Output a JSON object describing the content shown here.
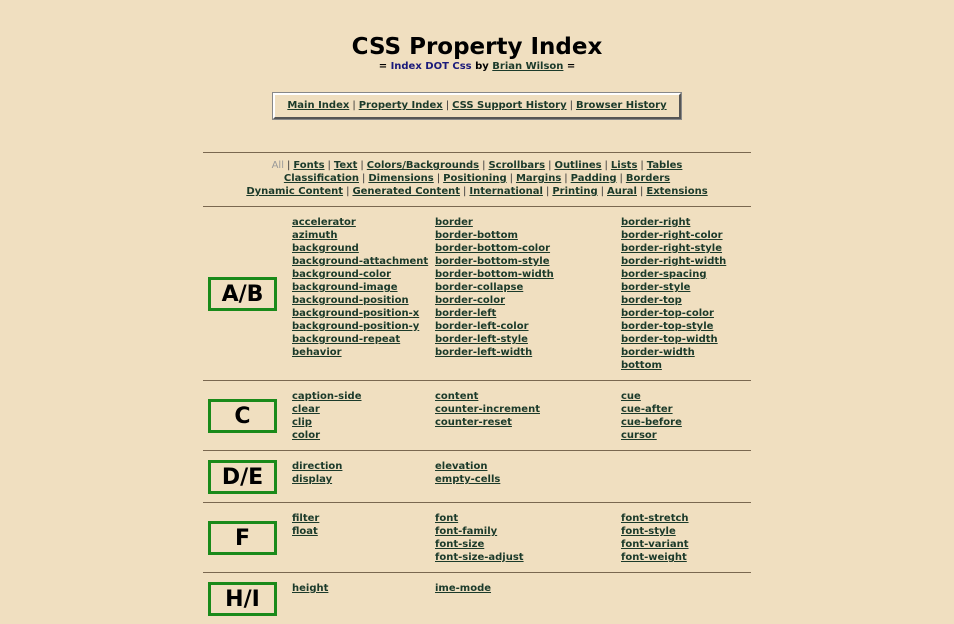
{
  "header": {
    "title": "CSS Property Index",
    "subtitle_prefix": "= ",
    "subtitle_site": "Index DOT Css",
    "subtitle_by": " by ",
    "subtitle_author": "Brian Wilson",
    "subtitle_suffix": " ="
  },
  "topnav": [
    "Main Index",
    "Property Index",
    "CSS Support History",
    "Browser History"
  ],
  "separator": "|",
  "catnav": {
    "current": "All",
    "rows": [
      [
        "Fonts",
        "Text",
        "Colors/Backgrounds",
        "Scrollbars",
        "Outlines",
        "Lists",
        "Tables"
      ],
      [
        "Classification",
        "Dimensions",
        "Positioning",
        "Margins",
        "Padding",
        "Borders"
      ],
      [
        "Dynamic Content",
        "Generated Content",
        "International",
        "Printing",
        "Aural",
        "Extensions"
      ]
    ]
  },
  "sections": [
    {
      "letter": "A/B",
      "columns": [
        [
          "accelerator",
          "azimuth",
          "background",
          "background-attachment",
          "background-color",
          "background-image",
          "background-position",
          "background-position-x",
          "background-position-y",
          "background-repeat",
          "behavior"
        ],
        [
          "border",
          "border-bottom",
          "border-bottom-color",
          "border-bottom-style",
          "border-bottom-width",
          "border-collapse",
          "border-color",
          "border-left",
          "border-left-color",
          "border-left-style",
          "border-left-width"
        ],
        [
          "border-right",
          "border-right-color",
          "border-right-style",
          "border-right-width",
          "border-spacing",
          "border-style",
          "border-top",
          "border-top-color",
          "border-top-style",
          "border-top-width",
          "border-width",
          "bottom"
        ]
      ]
    },
    {
      "letter": "C",
      "columns": [
        [
          "caption-side",
          "clear",
          "clip",
          "color"
        ],
        [
          "content",
          "counter-increment",
          "counter-reset"
        ],
        [
          "cue",
          "cue-after",
          "cue-before",
          "cursor"
        ]
      ]
    },
    {
      "letter": "D/E",
      "columns": [
        [
          "direction",
          "display"
        ],
        [
          "elevation",
          "empty-cells"
        ],
        []
      ]
    },
    {
      "letter": "F",
      "columns": [
        [
          "filter",
          "float"
        ],
        [
          "font",
          "font-family",
          "font-size",
          "font-size-adjust"
        ],
        [
          "font-stretch",
          "font-style",
          "font-variant",
          "font-weight"
        ]
      ]
    },
    {
      "letter": "H/I",
      "columns": [
        [
          "height"
        ],
        [
          "ime-mode"
        ],
        []
      ]
    }
  ]
}
